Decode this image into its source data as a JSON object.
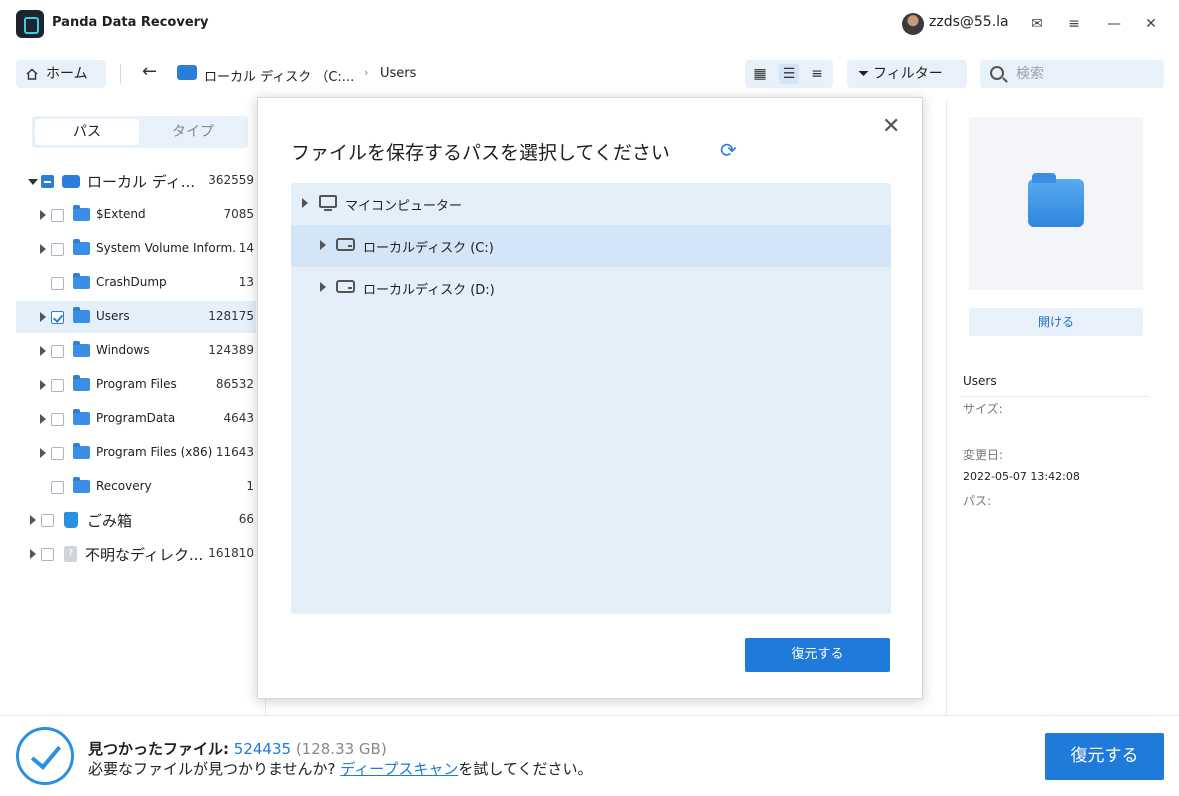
{
  "app": {
    "title": "Panda Data Recovery",
    "user": "zzds@55.la"
  },
  "window": {
    "mail_icon": "mail-icon",
    "menu_icon": "menu-icon",
    "minimize": "—",
    "close": "✕"
  },
  "toolbar": {
    "home_label": "ホーム",
    "back": "←",
    "breadcrumb": [
      "ローカル ディスク （C:...",
      "Users"
    ],
    "crumb_sep": "›",
    "filter_label": "フィルター",
    "search_placeholder": "検索"
  },
  "left": {
    "tabs": [
      "パス",
      "タイプ"
    ],
    "tree": [
      {
        "label": "ローカル ディ...",
        "count": "362559"
      },
      {
        "label": "$Extend",
        "count": "7085"
      },
      {
        "label": "System Volume Inform...",
        "count": "14"
      },
      {
        "label": "CrashDump",
        "count": "13"
      },
      {
        "label": "Users",
        "count": "128175"
      },
      {
        "label": "Windows",
        "count": "124389"
      },
      {
        "label": "Program Files",
        "count": "86532"
      },
      {
        "label": "ProgramData",
        "count": "4643"
      },
      {
        "label": "Program Files (x86)",
        "count": "11643"
      },
      {
        "label": "Recovery",
        "count": "1"
      },
      {
        "label": "ごみ箱",
        "count": "66"
      },
      {
        "label": "不明なディレク...",
        "count": "161810"
      }
    ]
  },
  "dialog": {
    "title": "ファイルを保存するパスを選択してください",
    "refresh": "⟳",
    "close": "✕",
    "items": [
      "マイコンピューター",
      "ローカルディスク (C:)",
      "ローカルディスク (D:)"
    ],
    "restore_label": "復元する"
  },
  "right": {
    "open_label": "開ける",
    "name": "Users",
    "size_label": "サイズ:",
    "modified_label": "変更日:",
    "modified_value": "2022-05-07 13:42:08",
    "path_label": "パス:"
  },
  "bottom": {
    "found_label": "見つかったファイル:",
    "found_count": "524435",
    "found_size": "(128.33 GB)",
    "hint_prefix": "必要なファイルが見つかりませんか? ",
    "hint_link": "ディープスキャン",
    "hint_suffix": "を試してください。",
    "restore_label": "復元する"
  },
  "colors": {
    "accent": "#1f7ad9",
    "panel_bg": "#e8f0fa",
    "selection": "#e6f0fb"
  }
}
